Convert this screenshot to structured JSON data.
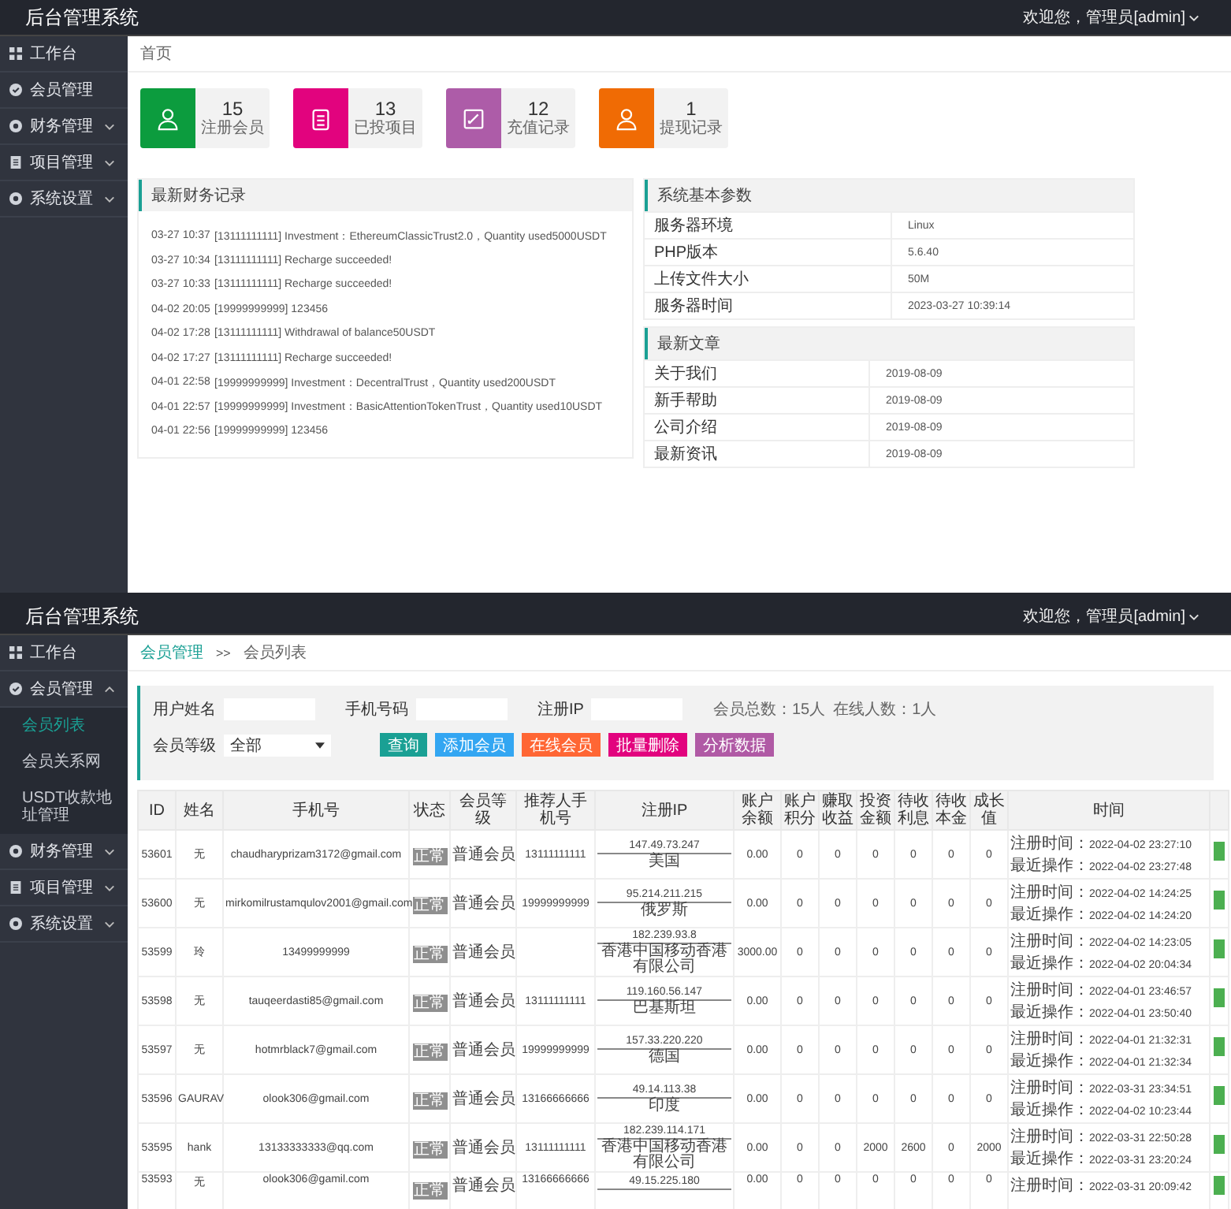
{
  "dashboard": {
    "header": {
      "title": "后台管理系统",
      "user": "欢迎您，管理员[admin]"
    },
    "sidebar": [
      {
        "label": "工作台"
      },
      {
        "label": "会员管理"
      },
      {
        "label": "财务管理",
        "expanded": false
      },
      {
        "label": "项目管理",
        "expanded": false
      },
      {
        "label": "系统设置",
        "expanded": false
      }
    ],
    "breadcrumb": "首页",
    "stats": [
      {
        "value": "15",
        "label": "注册会员",
        "color": "#0c9c3e"
      },
      {
        "value": "13",
        "label": "已投项目",
        "color": "#e2037e"
      },
      {
        "value": "12",
        "label": "充值记录",
        "color": "#ad5ca8"
      },
      {
        "value": "1",
        "label": "提现记录",
        "color": "#f06b04"
      }
    ],
    "finance_panel": {
      "title": "最新财务记录",
      "records": [
        {
          "time": "03-27 10:37",
          "text": "[13111111111] Investment：EthereumClassicTrust2.0，Quantity used5000USDT"
        },
        {
          "time": "03-27 10:34",
          "text": "[13111111111] Recharge succeeded!"
        },
        {
          "time": "03-27 10:33",
          "text": "[13111111111] Recharge succeeded!"
        },
        {
          "time": "04-02 20:05",
          "text": "[19999999999] 123456"
        },
        {
          "time": "04-02 17:28",
          "text": "[13111111111] Withdrawal of balance50USDT"
        },
        {
          "time": "04-02 17:27",
          "text": "[13111111111] Recharge succeeded!"
        },
        {
          "time": "04-01 22:58",
          "text": "[19999999999] Investment：DecentralTrust，Quantity used200USDT"
        },
        {
          "time": "04-01 22:57",
          "text": "[19999999999] Investment：BasicAttentionTokenTrust，Quantity used10USDT"
        },
        {
          "time": "04-01 22:56",
          "text": "[19999999999] 123456"
        }
      ]
    },
    "system_panel": {
      "title": "系统基本参数",
      "rows": [
        {
          "label": "服务器环境",
          "value": "Linux"
        },
        {
          "label": "PHP版本",
          "value": "5.6.40"
        },
        {
          "label": "上传文件大小",
          "value": "50M"
        },
        {
          "label": "服务器时间",
          "value": "2023-03-27 10:39:14"
        }
      ]
    },
    "articles_panel": {
      "title": "最新文章",
      "rows": [
        {
          "label": "关于我们",
          "value": "2019-08-09"
        },
        {
          "label": "新手帮助",
          "value": "2019-08-09"
        },
        {
          "label": "公司介绍",
          "value": "2019-08-09"
        },
        {
          "label": "最新资讯",
          "value": "2019-08-09"
        }
      ]
    }
  },
  "members": {
    "header": {
      "title": "后台管理系统",
      "user": "欢迎您，管理员[admin]"
    },
    "sidebar": [
      {
        "label": "工作台"
      },
      {
        "label": "会员管理",
        "expanded": true,
        "children": [
          {
            "label": "会员列表",
            "selected": true
          },
          {
            "label": "会员关系网",
            "selected": false
          },
          {
            "label": "USDT收款地址管理",
            "selected": false
          }
        ]
      },
      {
        "label": "财务管理",
        "expanded": false
      },
      {
        "label": "项目管理",
        "expanded": false
      },
      {
        "label": "系统设置",
        "expanded": false
      }
    ],
    "breadcrumb": {
      "separator": ">>",
      "items": [
        {
          "label": "会员管理",
          "selected": false
        },
        {
          "label": "会员列表",
          "selected": true
        }
      ]
    },
    "filters": {
      "fields": [
        {
          "label": "用户姓名"
        },
        {
          "label": "手机号码"
        },
        {
          "label": "注册IP"
        }
      ],
      "summary": [
        "会员总数：15人",
        "在线人数：1人"
      ],
      "select": {
        "label": "会员等级",
        "value": "全部"
      },
      "buttons": [
        {
          "label": "查询",
          "color": "#1aa094"
        },
        {
          "label": "添加会员",
          "color": "#33a6f2"
        },
        {
          "label": "在线会员",
          "color": "#ff6634"
        },
        {
          "label": "批量删除",
          "color": "#e2037e"
        },
        {
          "label": "分析数据",
          "color": "#b05aa5"
        }
      ]
    },
    "table": {
      "columns": [
        "ID",
        "姓名",
        "手机号",
        "状态",
        "会员等级",
        "推荐人手机号",
        "注册IP",
        "账户余额",
        "账户积分",
        "赚取收益",
        "投资金额",
        "待收利息",
        "待收本金",
        "成长值",
        "时间"
      ],
      "rows": [
        {
          "id": "53601",
          "name": "无",
          "phone": "chaudharyprizam3172@gmail.com",
          "status": "正常",
          "level": "普通会员",
          "referrer": "13111111111",
          "ip": "147.49.73.247",
          "location": "美国",
          "balance": "0.00",
          "stats": [
            "0",
            "0",
            "0",
            "0",
            "0",
            "0"
          ],
          "times": [
            {
              "label": "注册时间：",
              "value": "2022-04-02 23:27:10"
            },
            {
              "label": "最近操作：",
              "value": "2022-04-02 23:27:48"
            }
          ],
          "enabled": true
        },
        {
          "id": "53600",
          "name": "无",
          "phone": "mirkomilrustamqulov2001@gmail.com",
          "status": "正常",
          "level": "普通会员",
          "referrer": "19999999999",
          "ip": "95.214.211.215",
          "location": "俄罗斯",
          "balance": "0.00",
          "stats": [
            "0",
            "0",
            "0",
            "0",
            "0",
            "0"
          ],
          "times": [
            {
              "label": "注册时间：",
              "value": "2022-04-02 14:24:25"
            },
            {
              "label": "最近操作：",
              "value": "2022-04-02 14:24:20"
            }
          ],
          "enabled": true
        },
        {
          "id": "53599",
          "name": "玲",
          "phone": "13499999999",
          "status": "正常",
          "level": "普通会员",
          "ip": "182.239.93.8",
          "location": "香港中国移动香港有限公司",
          "balance": "3000.00",
          "stats": [
            "0",
            "0",
            "0",
            "0",
            "0",
            "0"
          ],
          "times": [
            {
              "label": "注册时间：",
              "value": "2022-04-02 14:23:05"
            },
            {
              "label": "最近操作：",
              "value": "2022-04-02 20:04:34"
            }
          ],
          "enabled": true
        },
        {
          "id": "53598",
          "name": "无",
          "phone": "tauqeerdasti85@gmail.com",
          "status": "正常",
          "level": "普通会员",
          "referrer": "13111111111",
          "ip": "119.160.56.147",
          "location": "巴基斯坦",
          "balance": "0.00",
          "stats": [
            "0",
            "0",
            "0",
            "0",
            "0",
            "0"
          ],
          "times": [
            {
              "label": "注册时间：",
              "value": "2022-04-01 23:46:57"
            },
            {
              "label": "最近操作：",
              "value": "2022-04-01 23:50:40"
            }
          ],
          "enabled": true
        },
        {
          "id": "53597",
          "name": "无",
          "phone": "hotmrblack7@gmail.com",
          "status": "正常",
          "level": "普通会员",
          "referrer": "19999999999",
          "ip": "157.33.220.220",
          "location": "德国",
          "balance": "0.00",
          "stats": [
            "0",
            "0",
            "0",
            "0",
            "0",
            "0"
          ],
          "times": [
            {
              "label": "注册时间：",
              "value": "2022-04-01 21:32:31"
            },
            {
              "label": "最近操作：",
              "value": "2022-04-01 21:32:34"
            }
          ],
          "enabled": true
        },
        {
          "id": "53596",
          "name": "GAURAV",
          "phone": "olook306@gmail.com",
          "status": "正常",
          "level": "普通会员",
          "referrer": "13166666666",
          "ip": "49.14.113.38",
          "location": "印度",
          "balance": "0.00",
          "stats": [
            "0",
            "0",
            "0",
            "0",
            "0",
            "0"
          ],
          "times": [
            {
              "label": "注册时间：",
              "value": "2022-03-31 23:34:51"
            },
            {
              "label": "最近操作：",
              "value": "2022-04-02 10:23:44"
            }
          ],
          "enabled": true
        },
        {
          "id": "53595",
          "name": "hank",
          "phone": "13133333333@qq.com",
          "status": "正常",
          "level": "普通会员",
          "referrer": "13111111111",
          "ip": "182.239.114.171",
          "location": "香港中国移动香港有限公司",
          "balance": "0.00",
          "stats": [
            "0",
            "0",
            "2000",
            "2600",
            "0",
            "2000"
          ],
          "times": [
            {
              "label": "注册时间：",
              "value": "2022-03-31 22:50:28"
            },
            {
              "label": "最近操作：",
              "value": "2022-03-31 23:20:24"
            }
          ],
          "enabled": true
        },
        {
          "id": "53593",
          "name": "无",
          "phone": "olook306@gamil.com",
          "status": "正常",
          "level": "普通会员",
          "referrer": "13166666666",
          "ip": "49.15.225.180",
          "balance": "0.00",
          "stats": [
            "0",
            "0",
            "0",
            "0",
            "0",
            "0"
          ],
          "times": [
            {
              "label": "注册时间：",
              "value": "2022-03-31 20:09:42"
            }
          ],
          "enabled": true
        }
      ]
    }
  }
}
